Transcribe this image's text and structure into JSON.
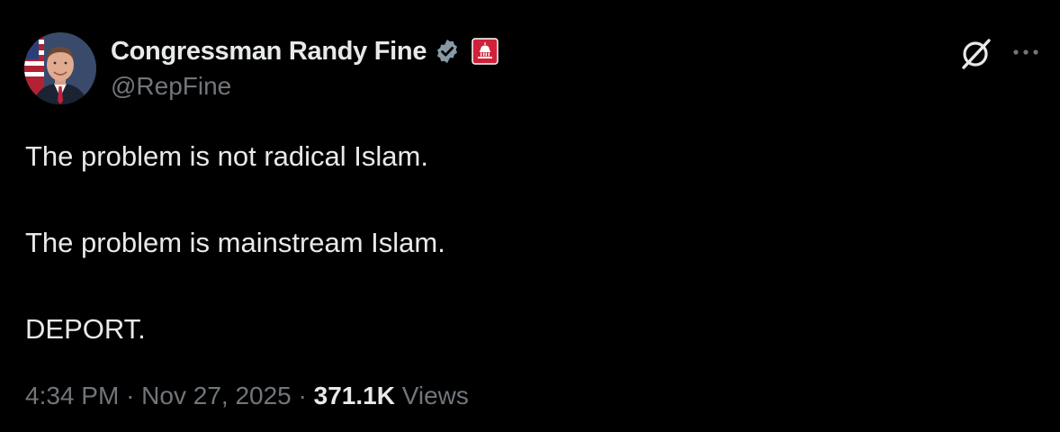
{
  "author": {
    "display_name": "Congressman Randy Fine",
    "handle": "@RepFine",
    "verified_icon": "verified-badge-icon",
    "affiliation_icon": "us-capitol-gov-badge-icon",
    "verified_color": "#8899a6",
    "affiliation_color": "#d0213a"
  },
  "header_actions": {
    "grok_icon": "grok-icon",
    "more_icon": "more-horizontal-icon"
  },
  "tweet": {
    "lines": [
      "The problem is not radical Islam.",
      "The problem is mainstream Islam.",
      "DEPORT."
    ]
  },
  "meta": {
    "time": "4:34 PM",
    "separator": "·",
    "date": "Nov 27, 2025",
    "views_count": "371.1K",
    "views_label": "Views"
  },
  "colors": {
    "background": "#000000",
    "primary_text": "#e7e9ea",
    "secondary_text": "#71767b"
  }
}
